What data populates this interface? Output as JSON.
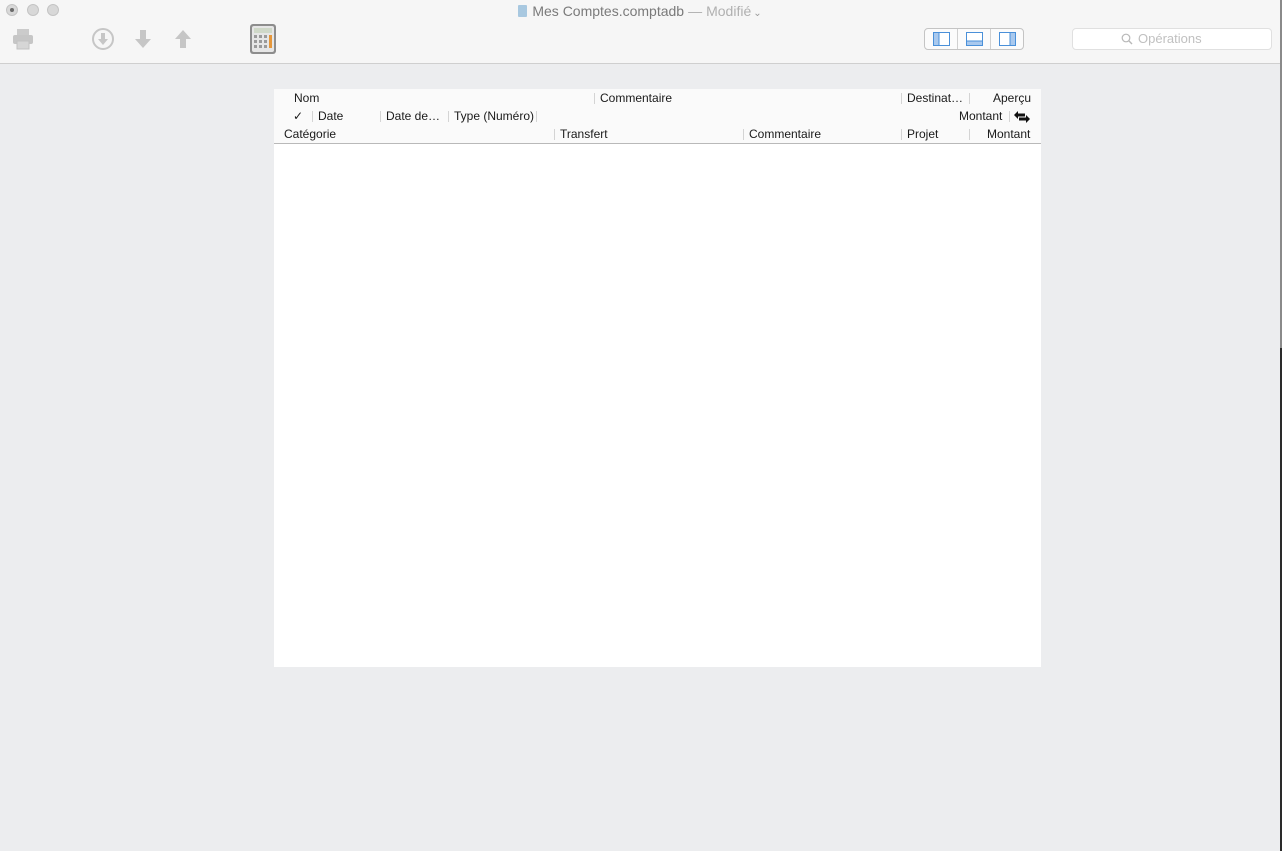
{
  "window": {
    "title": "Mes Comptes.comptadb",
    "separator": "—",
    "status": "Modifié"
  },
  "toolbar": {
    "icons": [
      "printer-icon",
      "download-circle-icon",
      "arrow-down-icon",
      "arrow-up-icon",
      "calculator-icon"
    ],
    "view_buttons": [
      "left-pane-icon",
      "bottom-pane-icon",
      "right-pane-icon"
    ]
  },
  "search": {
    "placeholder": "Opérations"
  },
  "table_header": {
    "row1": {
      "nom": "Nom",
      "commentaire": "Commentaire",
      "destination": "Destinat…",
      "apercu": "Aperçu"
    },
    "row2": {
      "check": "✓",
      "date": "Date",
      "date_de": "Date de…",
      "type": "Type (Numéro)",
      "montant": "Montant"
    },
    "row3": {
      "categorie": "Catégorie",
      "transfert": "Transfert",
      "commentaire": "Commentaire",
      "projet": "Projet",
      "montant": "Montant"
    }
  },
  "colors": {
    "background": "#ecedef",
    "toolbar": "#f6f6f6",
    "disabled_icon": "#c9c9c9",
    "accent_blue": "#4a90d9"
  }
}
